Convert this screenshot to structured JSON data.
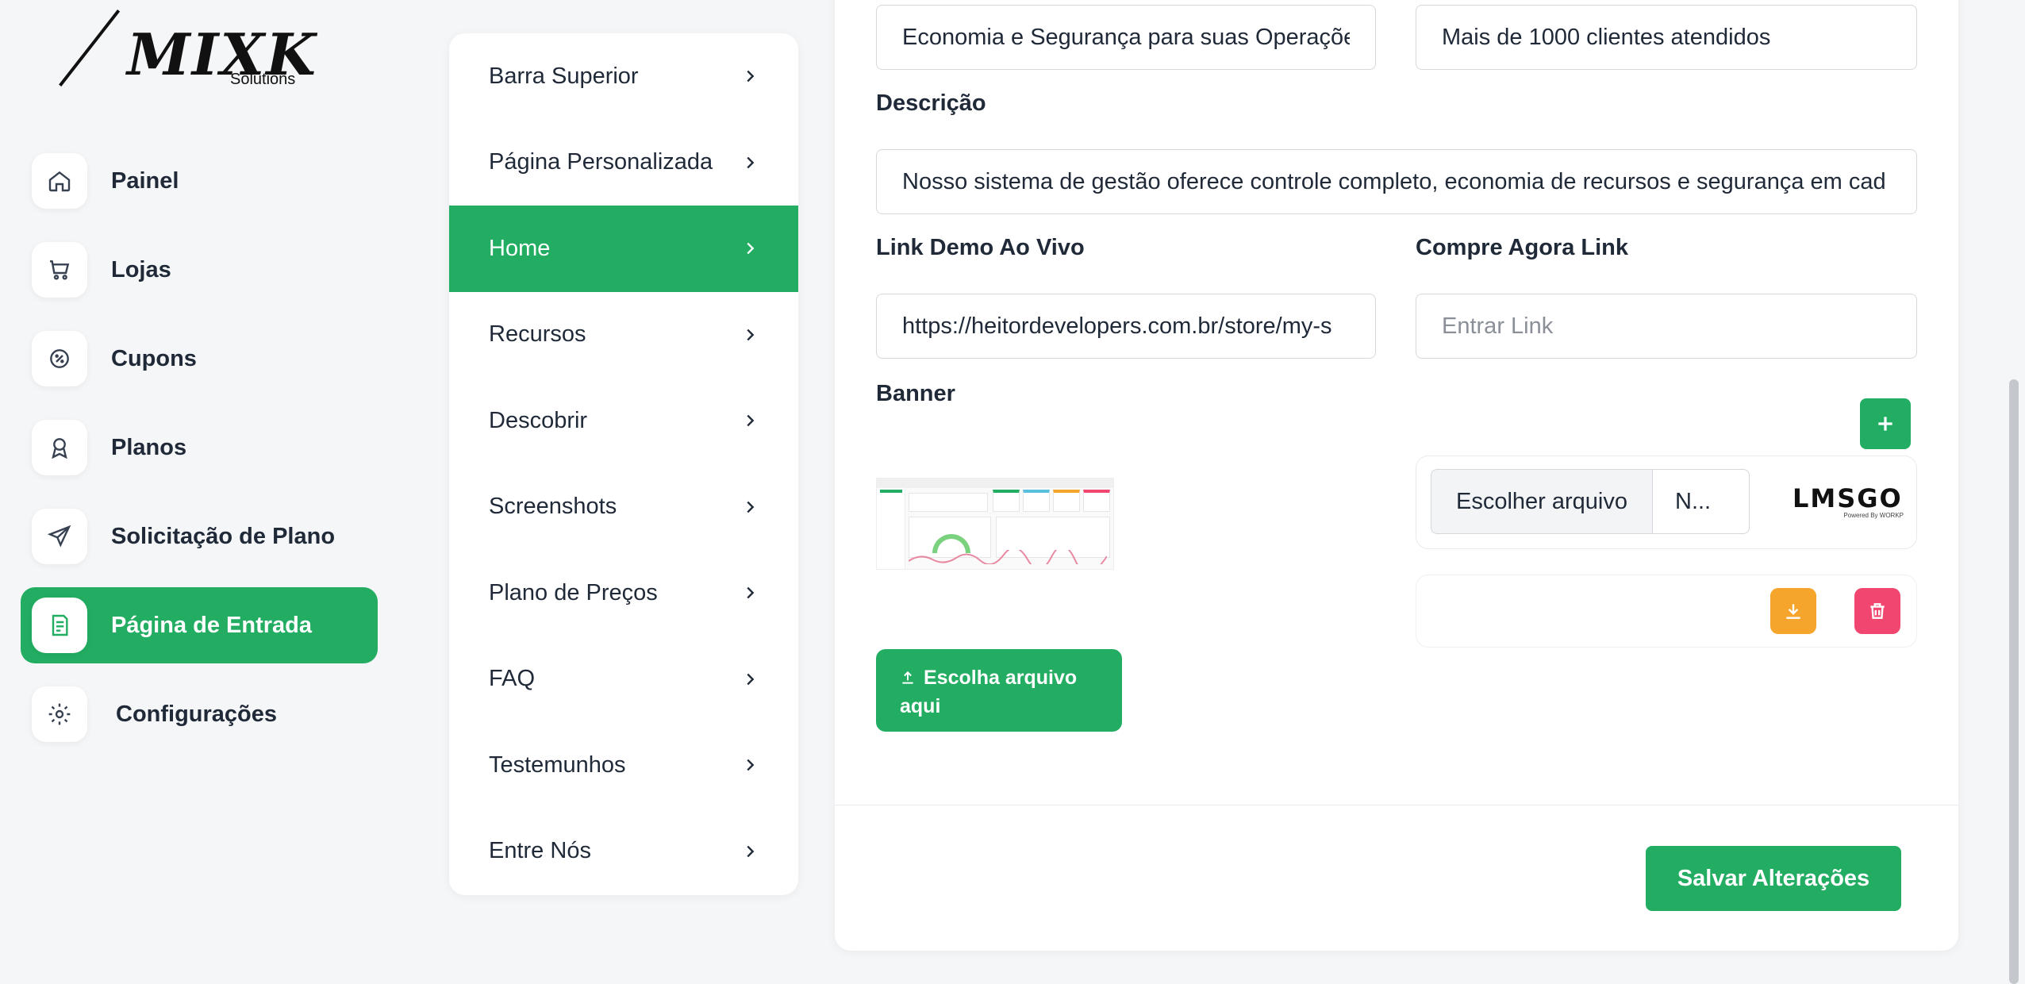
{
  "logo": {
    "brand_text": "MIXK",
    "brand_sub": "Solutions"
  },
  "sidebar": {
    "items": [
      {
        "label": "Painel",
        "icon": "home-icon"
      },
      {
        "label": "Lojas",
        "icon": "cart-icon"
      },
      {
        "label": "Cupons",
        "icon": "coupon-icon"
      },
      {
        "label": "Planos",
        "icon": "award-icon"
      },
      {
        "label": "Solicitação de Plano",
        "icon": "send-icon"
      },
      {
        "label": "Página de Entrada",
        "icon": "document-icon",
        "active": true
      },
      {
        "label": "Configurações",
        "icon": "gear-icon"
      }
    ]
  },
  "submenu": {
    "items": [
      {
        "label": "Barra Superior"
      },
      {
        "label": "Página Personalizada"
      },
      {
        "label": "Home",
        "active": true
      },
      {
        "label": "Recursos"
      },
      {
        "label": "Descobrir"
      },
      {
        "label": "Screenshots"
      },
      {
        "label": "Plano de Preços"
      },
      {
        "label": "FAQ"
      },
      {
        "label": "Testemunhos"
      },
      {
        "label": "Entre Nós"
      }
    ]
  },
  "form": {
    "heading_value": "Economia e Segurança para suas Operaçõe",
    "subtitle_value": "Mais de 1000 clientes atendidos",
    "description_label": "Descrição",
    "description_value": "Nosso sistema de gestão oferece controle completo, economia de recursos e segurança em cad",
    "live_demo_label": "Link Demo Ao Vivo",
    "live_demo_value": "https://heitordevelopers.com.br/store/my-s",
    "buy_now_label": "Compre Agora Link",
    "buy_now_placeholder": "Entrar Link",
    "banner_label": "Banner",
    "upload_button": "Escolha arquivo aqui",
    "file_choose_label": "Escolher arquivo",
    "file_name": "N...",
    "file_logo_text": "LMSGO",
    "file_logo_sub": "Powered By WORKP",
    "save_button": "Salvar Alterações"
  },
  "colors": {
    "accent": "#22ad62",
    "download": "#f5a52b",
    "delete": "#f0466f",
    "logo_accent": "#f0843a"
  }
}
